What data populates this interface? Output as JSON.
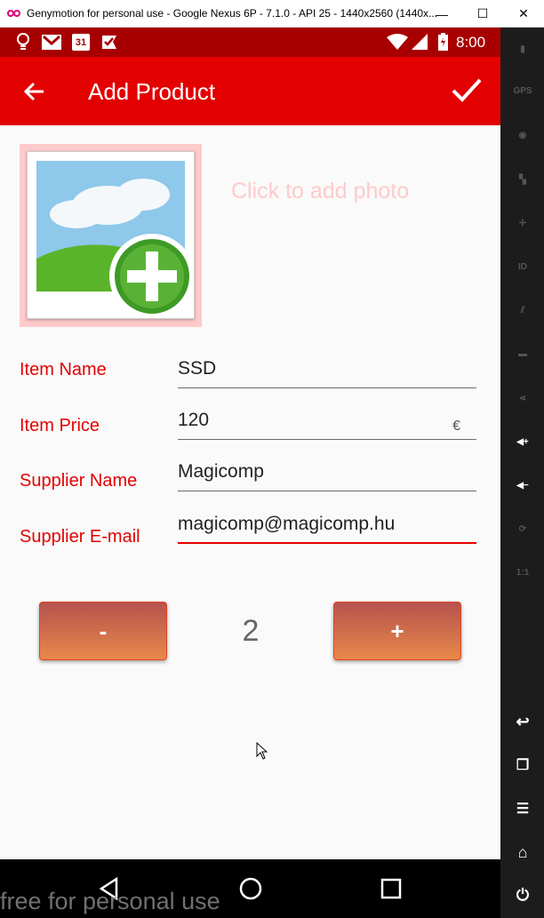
{
  "window": {
    "title": "Genymotion for personal use - Google Nexus 6P - 7.1.0 - API 25 - 1440x2560 (1440x...",
    "app_icon": "genymotion-logo-icon",
    "min_icon": "minimize-icon",
    "max_icon": "maximize-icon",
    "close_icon": "close-icon",
    "min_glyph": "—",
    "max_glyph": "☐",
    "close_glyph": "✕"
  },
  "statusbar": {
    "time": "8:00",
    "calendar_day": "31",
    "left_icons": [
      "lightbulb-icon",
      "gmail-icon",
      "calendar-icon",
      "task-check-icon"
    ],
    "right_icons": [
      "wifi-icon",
      "cell-signal-icon",
      "battery-charging-icon"
    ]
  },
  "appbar": {
    "title": "Add Product",
    "back_icon": "arrow-back-icon",
    "save_icon": "checkmark-icon",
    "color": "#e30000"
  },
  "photo": {
    "hint": "Click to add photo",
    "icon": "add-photo-icon"
  },
  "form": {
    "item_name_label": "Item Name",
    "item_name_value": "SSD",
    "item_price_label": "Item Price",
    "item_price_value": "120",
    "currency": "€",
    "supplier_name_label": "Supplier Name",
    "supplier_name_value": "Magicomp",
    "supplier_email_label": "Supplier E-mail",
    "supplier_email_value": "magicomp@magicomp.hu"
  },
  "quantity": {
    "minus_label": "-",
    "plus_label": "+",
    "value": "2"
  },
  "navbar": {
    "icons": [
      "nav-back-triangle-icon",
      "nav-home-circle-icon",
      "nav-recents-square-icon"
    ]
  },
  "watermark": "free for personal use",
  "sidebar": {
    "tools": [
      {
        "name": "battery-tool-icon",
        "glyph": "▮"
      },
      {
        "name": "gps-tool-icon",
        "glyph": "GPS"
      },
      {
        "name": "webcam-tool-icon",
        "glyph": "◉"
      },
      {
        "name": "capture-tool-icon",
        "glyph": "▚"
      },
      {
        "name": "remote-control-tool-icon",
        "glyph": "✛"
      },
      {
        "name": "identifiers-tool-icon",
        "glyph": "ID"
      },
      {
        "name": "network-tool-icon",
        "glyph": "⫽"
      },
      {
        "name": "sms-tool-icon",
        "glyph": "▬"
      },
      {
        "name": "share-tool-icon",
        "glyph": "⋖"
      },
      {
        "name": "volume-up-tool-icon",
        "glyph": "◀+"
      },
      {
        "name": "volume-down-tool-icon",
        "glyph": "◀−"
      },
      {
        "name": "rotate-tool-icon",
        "glyph": "⟳"
      },
      {
        "name": "pixel-perfect-tool-icon",
        "glyph": "1:1"
      },
      {
        "name": "back-tool-icon",
        "glyph": "↩"
      },
      {
        "name": "recent-apps-tool-icon",
        "glyph": "❐"
      },
      {
        "name": "menu-tool-icon",
        "glyph": "☰"
      },
      {
        "name": "home-tool-icon",
        "glyph": "⌂"
      },
      {
        "name": "power-tool-icon",
        "glyph": "⏻"
      }
    ]
  }
}
